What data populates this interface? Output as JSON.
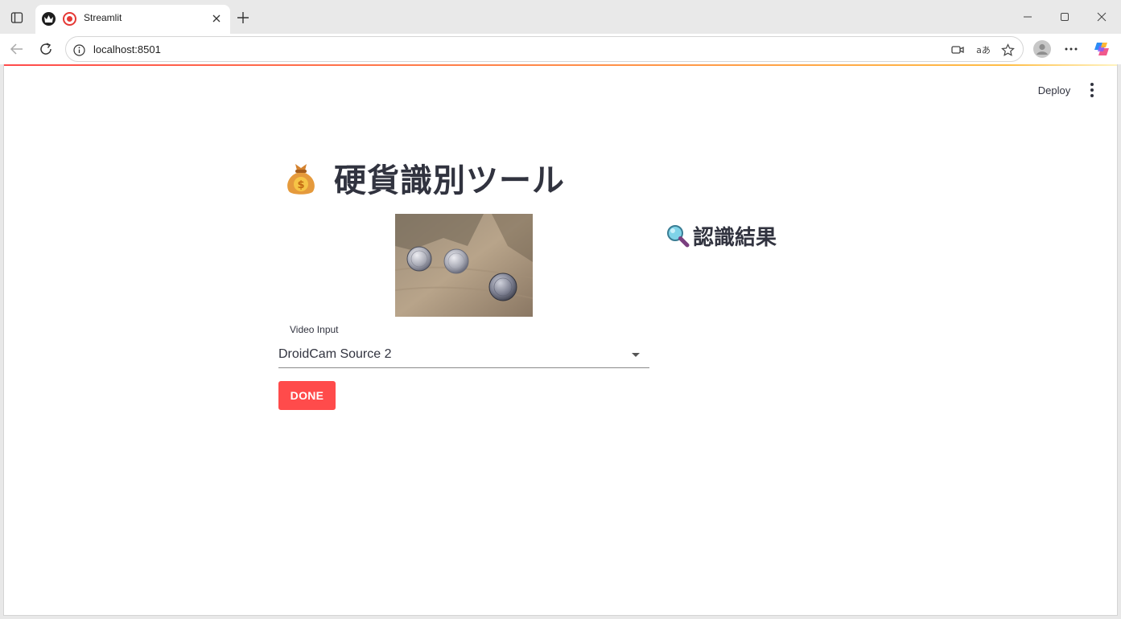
{
  "browser": {
    "tab_title": "Streamlit",
    "url": "localhost:8501",
    "icons": [
      "tab-actions-icon",
      "streamlit-crown-icon",
      "record-icon",
      "close-icon",
      "plus-icon",
      "minimize-icon",
      "maximize-icon",
      "close-window-icon",
      "back-arrow-icon",
      "reload-icon",
      "info-icon",
      "camera-icon",
      "translate-icon",
      "star-icon",
      "profile-icon",
      "more-horizontal-icon",
      "copilot-icon"
    ],
    "translate_glyph": "aあ"
  },
  "header": {
    "deploy_label": "Deploy",
    "menu_icon": "more-vertical-icon"
  },
  "main": {
    "title_icon": "money-bag-icon",
    "title": "硬貨識別ツール",
    "video_frame": "coins-camera-frame",
    "select": {
      "label": "Video Input",
      "value": "DroidCam Source 2"
    },
    "done_label": "DONE",
    "result_icon": "magnifier-icon",
    "result_title": "認識結果"
  },
  "colors": {
    "accent": "#ff4b4b",
    "text": "#31333f",
    "decoration_start": "#ff4b4b",
    "decoration_end": "#ffbd45"
  }
}
